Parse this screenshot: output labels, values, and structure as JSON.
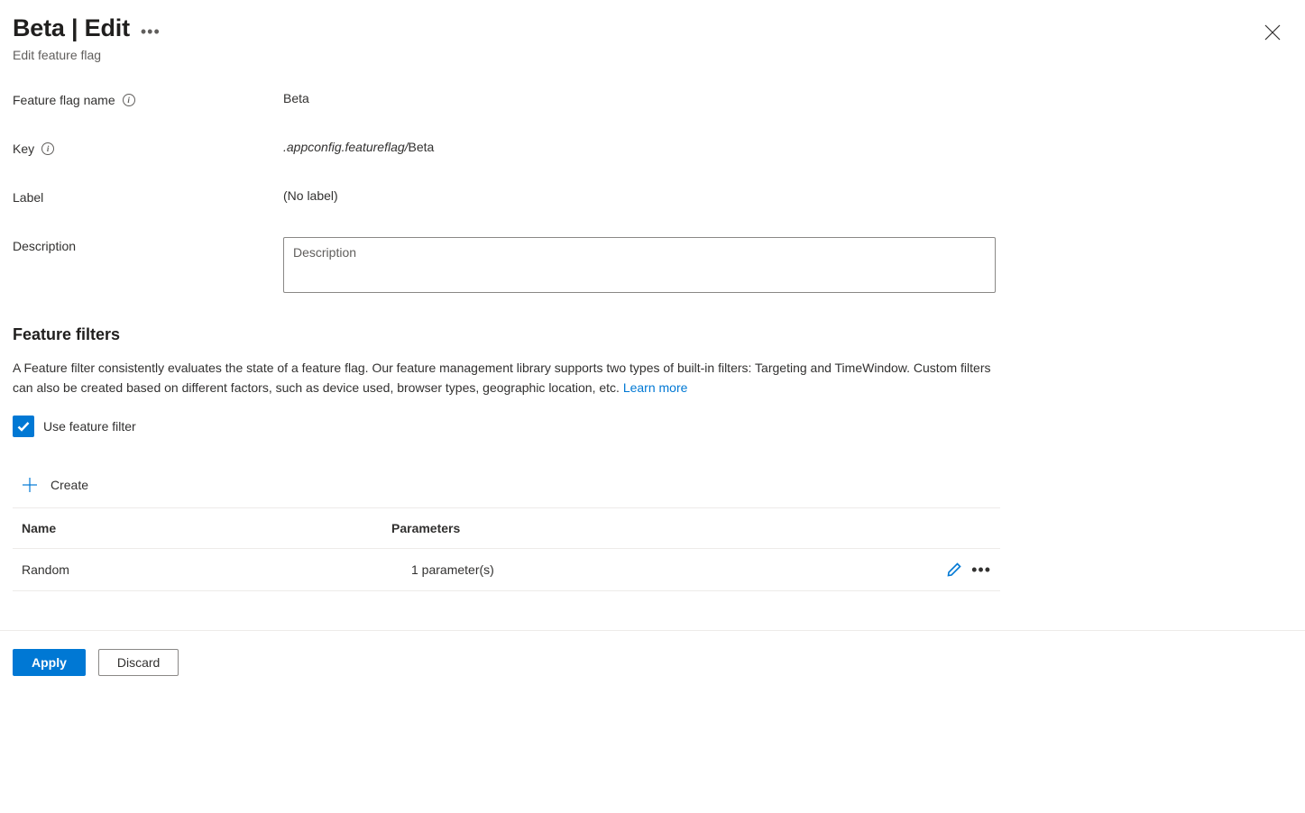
{
  "header": {
    "title": "Beta | Edit",
    "subtitle": "Edit feature flag"
  },
  "form": {
    "name_label": "Feature flag name",
    "name_value": "Beta",
    "key_label": "Key",
    "key_prefix": ".appconfig.featureflag/",
    "key_value": "Beta",
    "label_label": "Label",
    "label_value": "(No label)",
    "description_label": "Description",
    "description_placeholder": "Description"
  },
  "filters": {
    "heading": "Feature filters",
    "description": "A Feature filter consistently evaluates the state of a feature flag. Our feature management library supports two types of built-in filters: Targeting and TimeWindow. Custom filters can also be created based on different factors, such as device used, browser types, geographic location, etc. ",
    "learn_more": "Learn more",
    "checkbox_label": "Use feature filter",
    "checkbox_checked": true,
    "create_label": "Create",
    "table": {
      "col_name": "Name",
      "col_params": "Parameters",
      "rows": [
        {
          "name": "Random",
          "params": "1 parameter(s)"
        }
      ]
    }
  },
  "footer": {
    "apply": "Apply",
    "discard": "Discard"
  }
}
